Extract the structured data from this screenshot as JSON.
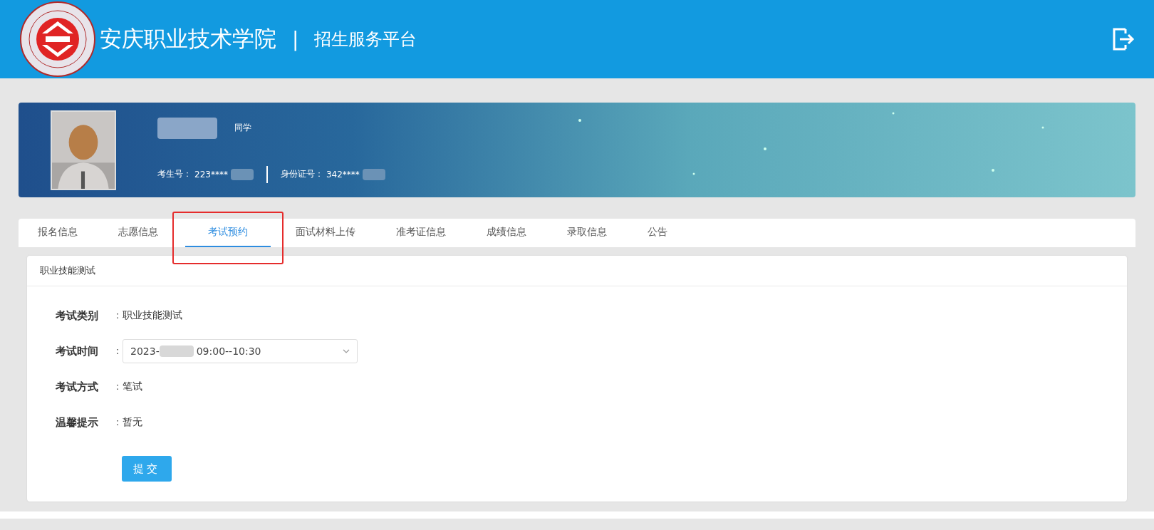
{
  "header": {
    "school": "安庆职业技术学院",
    "separator": "|",
    "platform": "招生服务平台"
  },
  "profile": {
    "suffix": "同学",
    "exam_no_label": "考生号：",
    "exam_no": "223****",
    "id_label": "身份证号：",
    "id_no": "342****"
  },
  "tabs": [
    {
      "label": "报名信息",
      "selected": false
    },
    {
      "label": "志愿信息",
      "selected": false
    },
    {
      "label": "考试预约",
      "selected": true
    },
    {
      "label": "面试材料上传",
      "selected": false
    },
    {
      "label": "准考证信息",
      "selected": false
    },
    {
      "label": "成绩信息",
      "selected": false
    },
    {
      "label": "录取信息",
      "selected": false
    },
    {
      "label": "公告",
      "selected": false
    }
  ],
  "panel": {
    "title": "职业技能测试",
    "fields": [
      {
        "kind": "text",
        "label": "考试类别",
        "colon": "：",
        "value": "职业技能测试"
      },
      {
        "kind": "select",
        "label": "考试时间",
        "colon": "：",
        "value_start": "2023-",
        "value_end": "09:00--10:30"
      },
      {
        "kind": "text",
        "label": "考试方式",
        "colon": "：",
        "value": "笔试"
      },
      {
        "kind": "text",
        "label": "温馨提示",
        "colon": "：",
        "value": "暂无"
      }
    ],
    "submit": "提交"
  }
}
